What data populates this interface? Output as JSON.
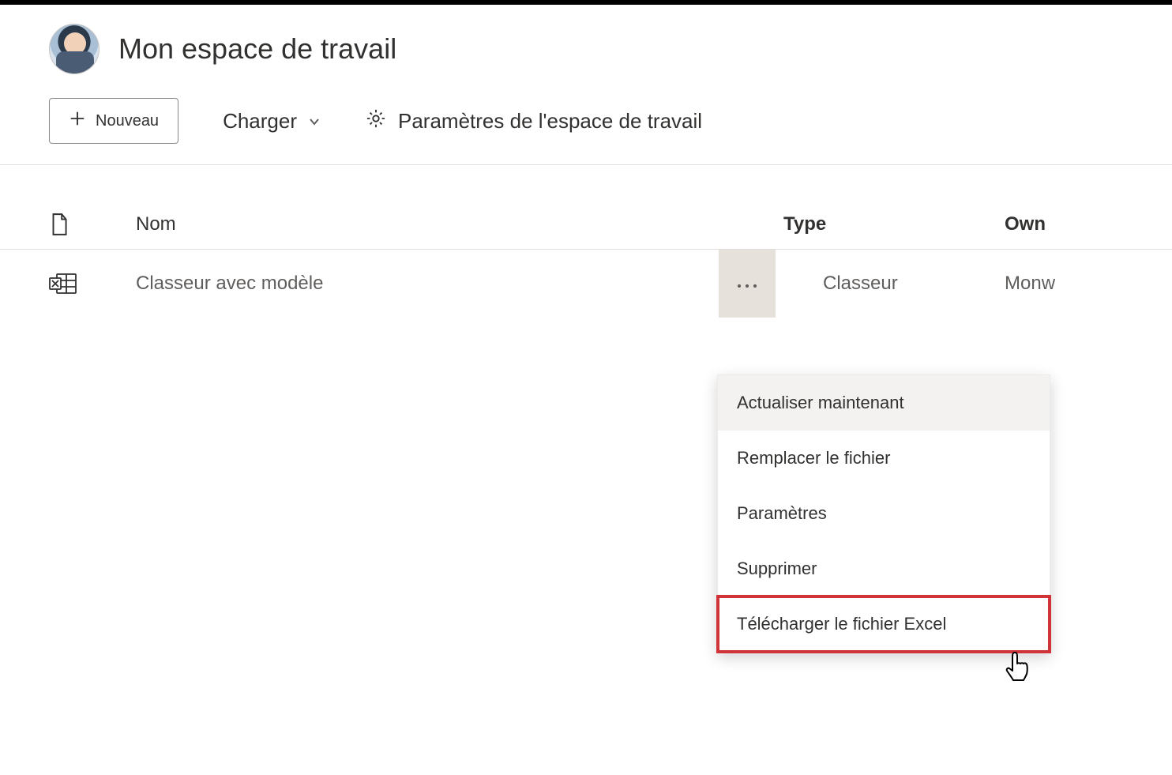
{
  "header": {
    "workspace_title": "Mon espace de travail"
  },
  "toolbar": {
    "new_label": "Nouveau",
    "upload_label": "Charger",
    "settings_label": "Paramètres de l'espace de travail"
  },
  "table": {
    "columns": {
      "name": "Nom",
      "type": "Type",
      "owner": "Own"
    },
    "rows": [
      {
        "name": "Classeur avec modèle",
        "type": "Classeur",
        "owner": "Monw"
      }
    ]
  },
  "context_menu": {
    "items": [
      "Actualiser maintenant",
      "Remplacer le fichier",
      "Paramètres",
      "Supprimer",
      "Télécharger le fichier Excel"
    ]
  }
}
